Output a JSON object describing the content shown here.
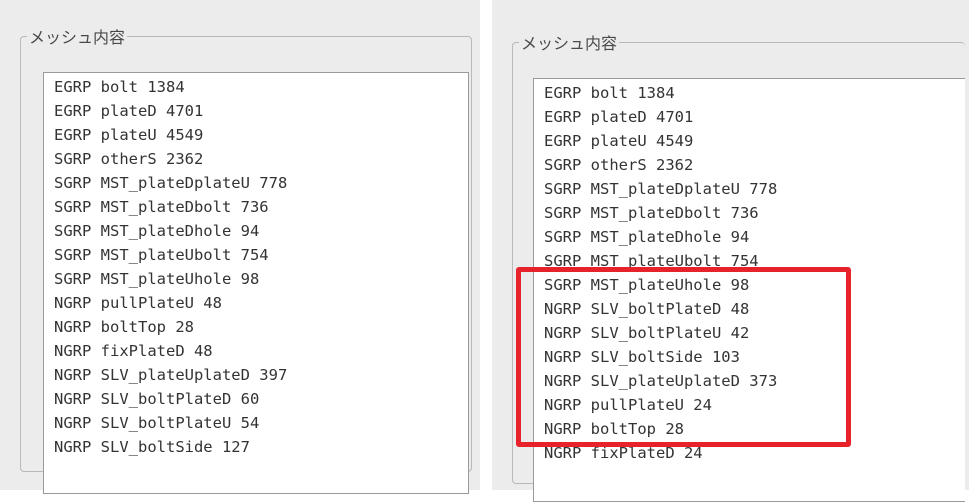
{
  "left": {
    "legend": "メッシュ内容",
    "lines": [
      "EGRP bolt 1384",
      "EGRP plateD 4701",
      "EGRP plateU 4549",
      "SGRP otherS 2362",
      "SGRP MST_plateDplateU 778",
      "SGRP MST_plateDbolt 736",
      "SGRP MST_plateDhole 94",
      "SGRP MST_plateUbolt 754",
      "SGRP MST_plateUhole 98",
      "NGRP pullPlateU 48",
      "NGRP boltTop 28",
      "NGRP fixPlateD 48",
      "NGRP SLV_plateUplateD 397",
      "NGRP SLV_boltPlateD 60",
      "NGRP SLV_boltPlateU 54",
      "NGRP SLV_boltSide 127"
    ]
  },
  "right": {
    "legend": "メッシュ内容",
    "lines": [
      "EGRP bolt 1384",
      "EGRP plateD 4701",
      "EGRP plateU 4549",
      "SGRP otherS 2362",
      "SGRP MST_plateDplateU 778",
      "SGRP MST_plateDbolt 736",
      "SGRP MST_plateDhole 94",
      "SGRP MST_plateUbolt 754",
      "SGRP MST_plateUhole 98",
      "NGRP SLV_boltPlateD 48",
      "NGRP SLV_boltPlateU 42",
      "NGRP SLV_boltSide 103",
      "NGRP SLV_plateUplateD 373",
      "NGRP pullPlateU 24",
      "NGRP boltTop 28",
      "NGRP fixPlateD 24"
    ],
    "highlight_color": "#e8222b"
  }
}
